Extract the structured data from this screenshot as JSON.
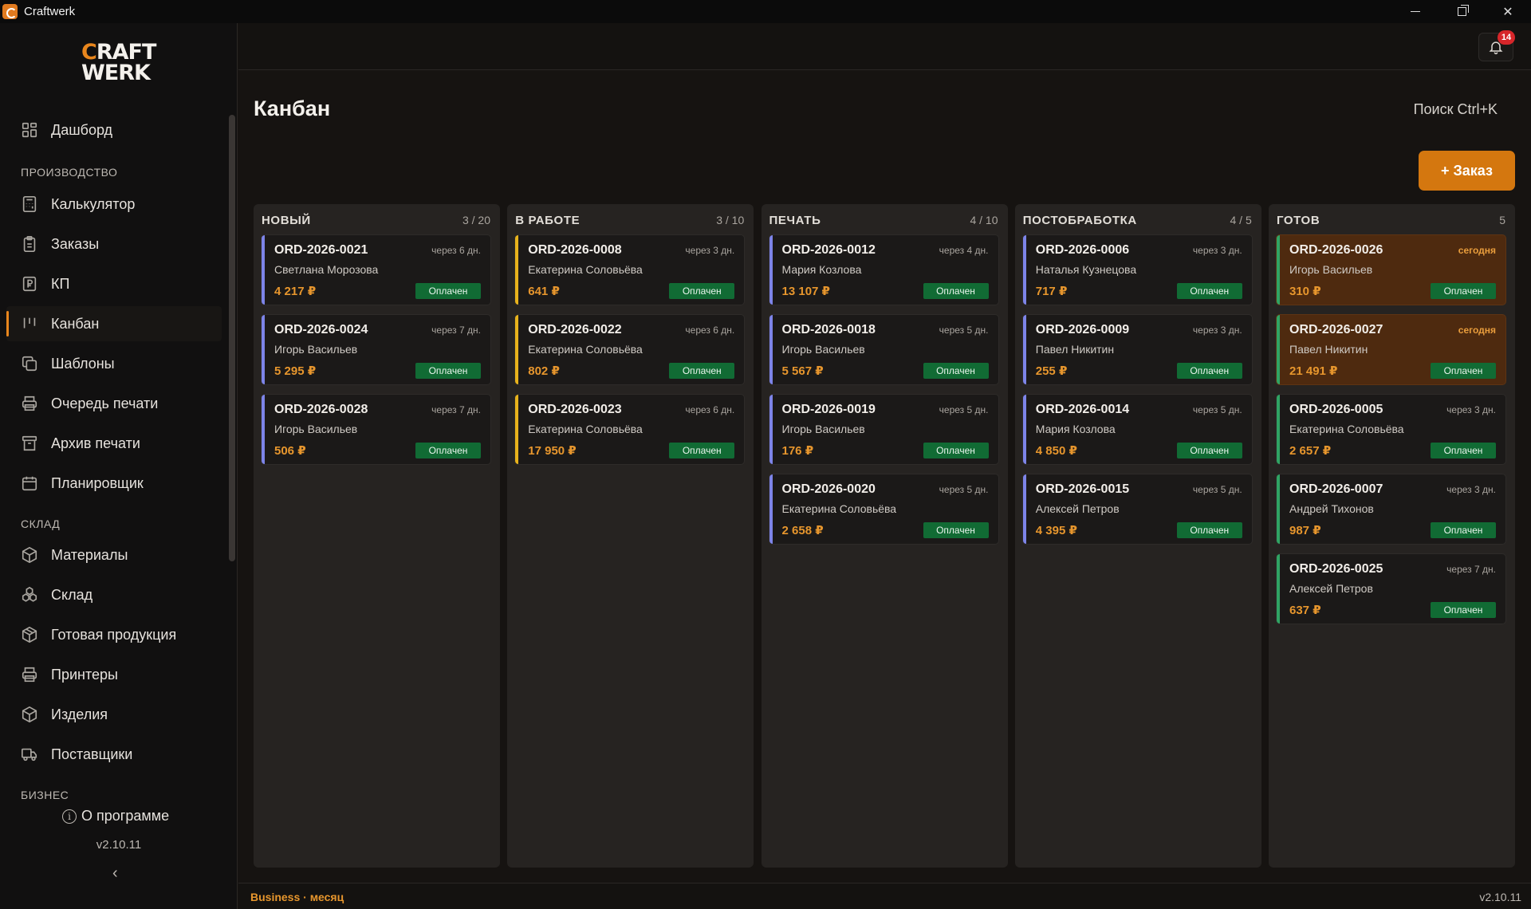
{
  "window": {
    "title": "Craftwerk"
  },
  "logo": {
    "line1_c": "C",
    "line1_rest": "RAFT",
    "line2": "WERK"
  },
  "colors": {
    "accent": "#e8861d",
    "paid": "#116b34",
    "urgent_card": "#4e2a0f"
  },
  "sidebar": {
    "dashboard": {
      "label": "Дашборд",
      "icon": "dashboard-icon"
    },
    "section_production": "ПРОИЗВОДСТВО",
    "production": [
      {
        "label": "Калькулятор",
        "icon": "calculator-icon"
      },
      {
        "label": "Заказы",
        "icon": "clipboard-icon"
      },
      {
        "label": "КП",
        "icon": "ruble-document-icon"
      },
      {
        "label": "Канбан",
        "icon": "kanban-icon",
        "active": true
      },
      {
        "label": "Шаблоны",
        "icon": "copy-icon"
      },
      {
        "label": "Очередь печати",
        "icon": "printer-icon"
      },
      {
        "label": "Архив печати",
        "icon": "archive-icon"
      },
      {
        "label": "Планировщик",
        "icon": "calendar-icon"
      }
    ],
    "section_warehouse": "СКЛАД",
    "warehouse": [
      {
        "label": "Материалы",
        "icon": "box-icon"
      },
      {
        "label": "Склад",
        "icon": "boxes-icon"
      },
      {
        "label": "Готовая продукция",
        "icon": "package-icon"
      },
      {
        "label": "Принтеры",
        "icon": "printer-icon"
      },
      {
        "label": "Изделия",
        "icon": "cube-icon"
      },
      {
        "label": "Поставщики",
        "icon": "truck-icon"
      }
    ],
    "section_business": "БИЗНЕС",
    "about": "О программе",
    "version": "v2.10.11",
    "collapse": "‹"
  },
  "topbar": {
    "notifications_count": "14"
  },
  "main": {
    "title": "Канбан",
    "search_hint": "Поиск  Ctrl+K",
    "add_order": "+ Заказ"
  },
  "columns": [
    {
      "title": "НОВЫЙ",
      "count": "3 / 20",
      "accent": "blue",
      "cards": [
        {
          "id": "ORD-2026-0021",
          "due": "через 6 дн.",
          "client": "Светлана Морозова",
          "price": "4 217 ₽",
          "status": "Оплачен"
        },
        {
          "id": "ORD-2026-0024",
          "due": "через 7 дн.",
          "client": "Игорь Васильев",
          "price": "5 295 ₽",
          "status": "Оплачен"
        },
        {
          "id": "ORD-2026-0028",
          "due": "через 7 дн.",
          "client": "Игорь Васильев",
          "price": "506 ₽",
          "status": "Оплачен"
        }
      ]
    },
    {
      "title": "В РАБОТЕ",
      "count": "3 / 10",
      "accent": "yellow",
      "cards": [
        {
          "id": "ORD-2026-0008",
          "due": "через 3 дн.",
          "client": "Екатерина Соловьёва",
          "price": "641 ₽",
          "status": "Оплачен"
        },
        {
          "id": "ORD-2026-0022",
          "due": "через 6 дн.",
          "client": "Екатерина Соловьёва",
          "price": "802 ₽",
          "status": "Оплачен"
        },
        {
          "id": "ORD-2026-0023",
          "due": "через 6 дн.",
          "client": "Екатерина Соловьёва",
          "price": "17 950 ₽",
          "status": "Оплачен"
        }
      ]
    },
    {
      "title": "ПЕЧАТЬ",
      "count": "4 / 10",
      "accent": "blue",
      "cards": [
        {
          "id": "ORD-2026-0012",
          "due": "через 4 дн.",
          "client": "Мария Козлова",
          "price": "13 107 ₽",
          "status": "Оплачен"
        },
        {
          "id": "ORD-2026-0018",
          "due": "через 5 дн.",
          "client": "Игорь Васильев",
          "price": "5 567 ₽",
          "status": "Оплачен"
        },
        {
          "id": "ORD-2026-0019",
          "due": "через 5 дн.",
          "client": "Игорь Васильев",
          "price": "176 ₽",
          "status": "Оплачен"
        },
        {
          "id": "ORD-2026-0020",
          "due": "через 5 дн.",
          "client": "Екатерина Соловьёва",
          "price": "2 658 ₽",
          "status": "Оплачен"
        }
      ]
    },
    {
      "title": "ПОСТОБРАБОТКА",
      "count": "4 / 5",
      "accent": "blue",
      "cards": [
        {
          "id": "ORD-2026-0006",
          "due": "через 3 дн.",
          "client": "Наталья Кузнецова",
          "price": "717 ₽",
          "status": "Оплачен"
        },
        {
          "id": "ORD-2026-0009",
          "due": "через 3 дн.",
          "client": "Павел Никитин",
          "price": "255 ₽",
          "status": "Оплачен"
        },
        {
          "id": "ORD-2026-0014",
          "due": "через 5 дн.",
          "client": "Мария Козлова",
          "price": "4 850 ₽",
          "status": "Оплачен"
        },
        {
          "id": "ORD-2026-0015",
          "due": "через 5 дн.",
          "client": "Алексей Петров",
          "price": "4 395 ₽",
          "status": "Оплачен"
        }
      ]
    },
    {
      "title": "ГОТОВ",
      "count": "5",
      "accent": "green",
      "cards": [
        {
          "id": "ORD-2026-0026",
          "due": "сегодня",
          "client": "Игорь Васильев",
          "price": "310 ₽",
          "status": "Оплачен",
          "urgent": true
        },
        {
          "id": "ORD-2026-0027",
          "due": "сегодня",
          "client": "Павел Никитин",
          "price": "21 491 ₽",
          "status": "Оплачен",
          "urgent": true
        },
        {
          "id": "ORD-2026-0005",
          "due": "через 3 дн.",
          "client": "Екатерина Соловьёва",
          "price": "2 657 ₽",
          "status": "Оплачен"
        },
        {
          "id": "ORD-2026-0007",
          "due": "через 3 дн.",
          "client": "Андрей Тихонов",
          "price": "987 ₽",
          "status": "Оплачен"
        },
        {
          "id": "ORD-2026-0025",
          "due": "через 7 дн.",
          "client": "Алексей Петров",
          "price": "637 ₽",
          "status": "Оплачен"
        }
      ]
    }
  ],
  "footer": {
    "plan": "Business · месяц",
    "version": "v2.10.11"
  }
}
